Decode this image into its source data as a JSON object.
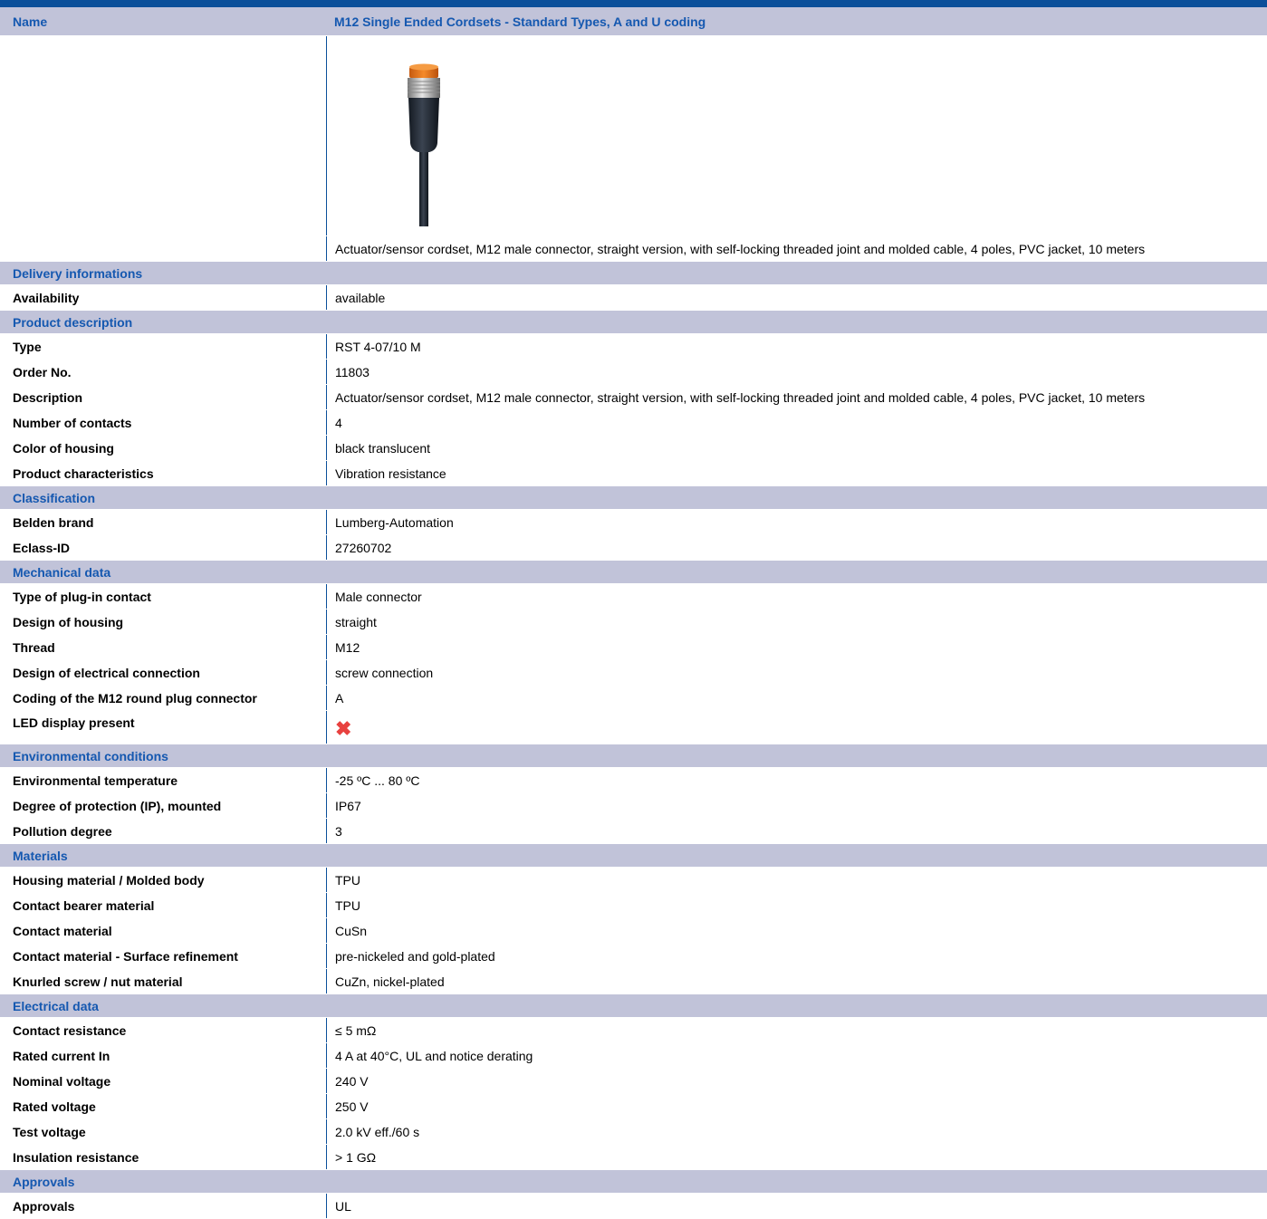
{
  "name_row": {
    "label": "Name",
    "value": "M12 Single Ended Cordsets - Standard Types, A and U coding"
  },
  "product_image": {
    "icon": "m12-connector-image"
  },
  "intro_description": "Actuator/sensor cordset, M12 male connector, straight version, with self-locking threaded joint and molded cable, 4 poles, PVC jacket, 10 meters",
  "sections": [
    {
      "title": "Delivery informations",
      "rows": [
        {
          "label": "Availability",
          "value": "available"
        }
      ]
    },
    {
      "title": "Product description",
      "rows": [
        {
          "label": "Type",
          "value": "RST 4-07/10 M"
        },
        {
          "label": "Order No.",
          "value": "11803"
        },
        {
          "label": "Description",
          "value": "Actuator/sensor cordset, M12 male connector, straight version, with self-locking threaded joint and molded cable, 4 poles, PVC jacket, 10 meters"
        },
        {
          "label": "Number of contacts",
          "value": "4"
        },
        {
          "label": "Color of housing",
          "value": "black translucent"
        },
        {
          "label": "Product characteristics",
          "value": "Vibration resistance"
        }
      ]
    },
    {
      "title": "Classification",
      "rows": [
        {
          "label": "Belden brand",
          "value": "Lumberg-Automation"
        },
        {
          "label": "Eclass-ID",
          "value": "27260702"
        }
      ]
    },
    {
      "title": "Mechanical data",
      "rows": [
        {
          "label": "Type of plug-in contact",
          "value": "Male connector"
        },
        {
          "label": "Design of housing",
          "value": "straight"
        },
        {
          "label": "Thread",
          "value": "M12"
        },
        {
          "label": "Design of electrical connection",
          "value": "screw connection"
        },
        {
          "label": "Coding of the M12 round plug connector",
          "value": "A"
        },
        {
          "label": "LED display present",
          "icon": "red-x-icon"
        }
      ]
    },
    {
      "title": "Environmental conditions",
      "rows": [
        {
          "label": "Environmental temperature",
          "value": "-25 ºC ... 80 ºC"
        },
        {
          "label": "Degree of protection (IP), mounted",
          "value": "IP67"
        },
        {
          "label": "Pollution degree",
          "value": "3"
        }
      ]
    },
    {
      "title": "Materials",
      "rows": [
        {
          "label": "Housing material / Molded body",
          "value": "TPU"
        },
        {
          "label": "Contact bearer material",
          "value": "TPU"
        },
        {
          "label": "Contact material",
          "value": "CuSn"
        },
        {
          "label": "Contact material - Surface refinement",
          "value": "pre-nickeled and gold-plated"
        },
        {
          "label": "Knurled screw / nut material",
          "value": "CuZn, nickel-plated"
        }
      ]
    },
    {
      "title": "Electrical data",
      "rows": [
        {
          "label": "Contact resistance",
          "value": "≤ 5 mΩ"
        },
        {
          "label": "Rated current In",
          "value": "4 A at 40°C, UL and notice derating"
        },
        {
          "label": "Nominal voltage",
          "value": "240 V"
        },
        {
          "label": "Rated voltage",
          "value": "250 V"
        },
        {
          "label": "Test voltage",
          "value": "2.0 kV eff./60 s"
        },
        {
          "label": "Insulation resistance",
          "value": "> 1 GΩ"
        }
      ]
    },
    {
      "title": "Approvals",
      "rows": [
        {
          "label": "Approvals",
          "value": "UL"
        }
      ]
    }
  ],
  "colors": {
    "header_bar": "#0b4f9a",
    "section_bg": "#c1c3d9",
    "section_text": "#1558b0",
    "x_mark": "#e8413f"
  }
}
